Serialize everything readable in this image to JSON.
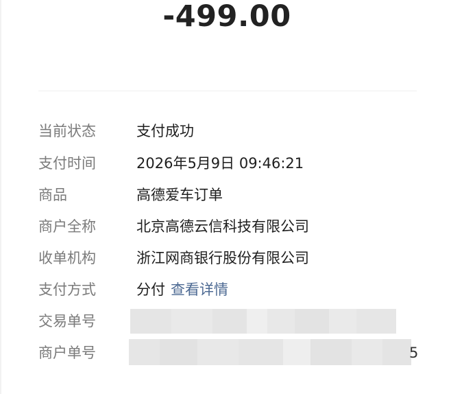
{
  "amount": "-499.00",
  "details": {
    "status": {
      "label": "当前状态",
      "value": "支付成功"
    },
    "pay_time": {
      "label": "支付时间",
      "value": "2026年5月9日 09:46:21"
    },
    "product": {
      "label": "商品",
      "value": "高德爱车订单"
    },
    "merchant": {
      "label": "商户全称",
      "value": "北京高德云信科技有限公司"
    },
    "acquirer": {
      "label": "收单机构",
      "value": "浙江网商银行股份有限公司"
    },
    "pay_method": {
      "label": "支付方式",
      "value": "分付",
      "link": "查看详情"
    },
    "trade_no": {
      "label": "交易单号"
    },
    "merchant_no": {
      "label": "商户单号",
      "visible_tail": "5"
    }
  },
  "colors": {
    "label": "#7a7a7a",
    "value": "#1e1e1e",
    "link": "#4d6a93",
    "mask": "#e6e6e6"
  }
}
